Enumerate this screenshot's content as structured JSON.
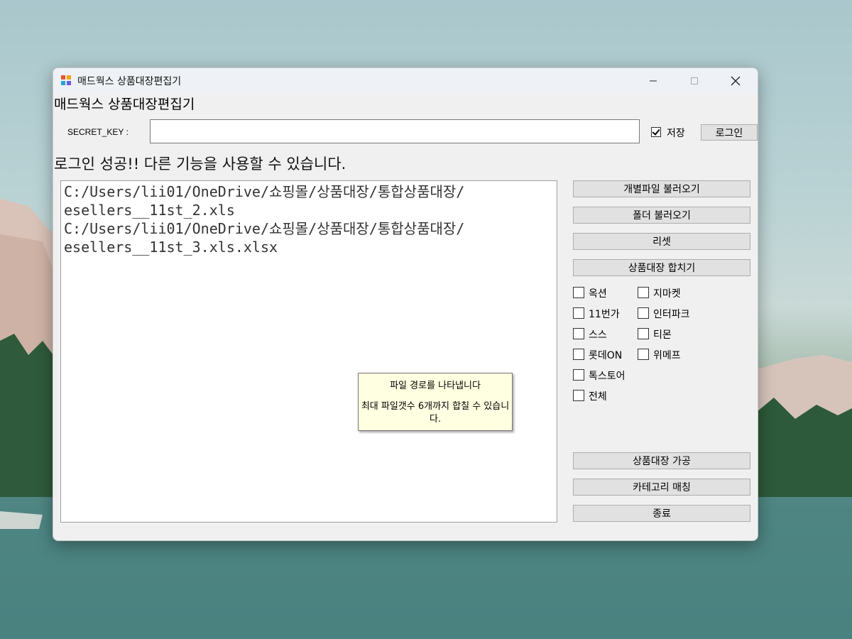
{
  "window": {
    "title": "매드웍스 상품대장편집기",
    "heading": "매드웍스 상품대장편집기",
    "minimize_icon": "minimize-icon",
    "maximize_icon": "maximize-icon",
    "close_icon": "close-icon"
  },
  "login": {
    "secret_key_label": "SECRET_KEY :",
    "secret_key_value": "",
    "save_label": "저장",
    "save_checked": true,
    "login_button": "로그인"
  },
  "status_text": "로그인 성공!! 다른 기능을 사용할 수 있습니다.",
  "file_list": {
    "lines": [
      "C:/Users/lii01/OneDrive/쇼핑몰/상품대장/통합상품대장/",
      "esellers__11st_2.xls",
      "C:/Users/lii01/OneDrive/쇼핑몰/상품대장/통합상품대장/",
      "esellers__11st_3.xls.xlsx"
    ]
  },
  "buttons": {
    "load_file": "개별파일 불러오기",
    "load_folder": "폴더 불러오기",
    "reset": "리셋",
    "merge": "상품대장 합치기",
    "process": "상품대장 가공",
    "category_match": "카테고리 매칭",
    "exit": "종료"
  },
  "markets": {
    "col1": [
      "옥션",
      "11번가",
      "스스",
      "롯데ON",
      "톡스토어",
      "전체"
    ],
    "col2": [
      "지마켓",
      "인터파크",
      "티몬",
      "위메프"
    ]
  },
  "tooltip": {
    "line1": "파일 경로를 나타냅니다",
    "line2": "최대 파일갯수 6개까지 합칠 수 있습니다."
  },
  "colors": {
    "window_bg": "#f0f0f0",
    "tooltip_bg": "#ffffe1",
    "button_bg": "#e1e1e1"
  }
}
